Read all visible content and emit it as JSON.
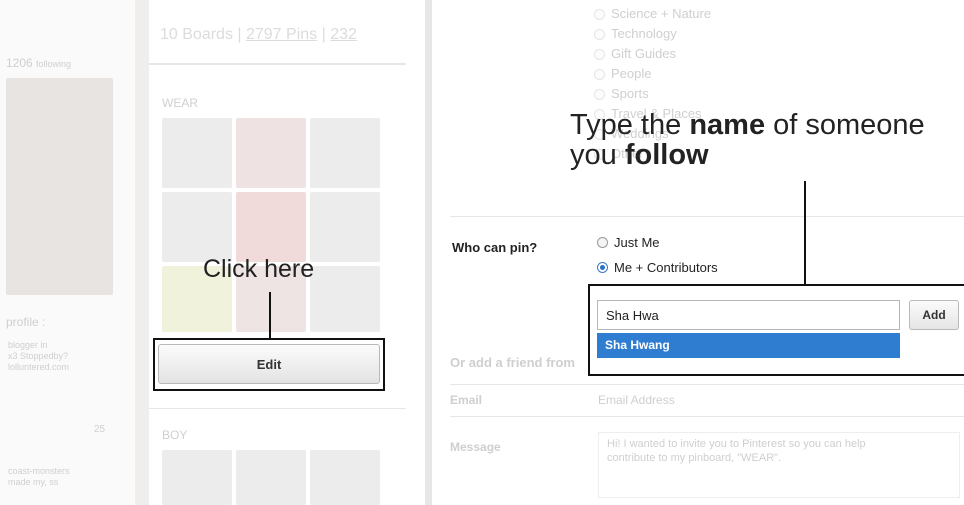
{
  "background_left": {
    "following_count": "1206",
    "following_label": "following",
    "boards_summary": {
      "boards": "10 Boards",
      "pins": "2797 Pins",
      "likes": "232"
    },
    "section_wear": "WEAR",
    "section_boy": "BOY",
    "profile_label": "profile :",
    "side_lines": [
      "blogger in",
      "x3 Stoppedby?",
      "lolluntered.com"
    ],
    "likes_count": "25",
    "bottom_lines": [
      "coast-monsters",
      "made my, ss"
    ]
  },
  "background_right": {
    "categories": [
      "Science + Nature",
      "Technology",
      "Gift Guides",
      "People",
      "Sports",
      "Travel & Places",
      "Weddings",
      "Other"
    ],
    "add_friend_label": "Or add a friend from",
    "email_label": "Email",
    "email_placeholder": "Email Address",
    "message_label": "Message",
    "message_text": "Hi! I wanted to invite you to Pinterest so you can help contribute to my pinboard, \"WEAR\"."
  },
  "annotations": {
    "click_here": "Click here",
    "type_name_line1_prefix": "Type the ",
    "type_name_line1_bold": "name",
    "type_name_line1_suffix": " of someone",
    "type_name_line2_prefix": "you ",
    "type_name_line2_bold": "follow"
  },
  "edit_button": {
    "label": "Edit"
  },
  "who_can_pin": {
    "label": "Who can pin?",
    "options": [
      {
        "label": "Just Me",
        "selected": false
      },
      {
        "label": "Me + Contributors",
        "selected": true
      }
    ]
  },
  "contributor_input": {
    "value": "Sha Hwa"
  },
  "add_button": {
    "label": "Add"
  },
  "suggestion": {
    "label": "Sha Hwang"
  },
  "colors": {
    "accent": "#2f7dd1",
    "callout": "#111111"
  }
}
